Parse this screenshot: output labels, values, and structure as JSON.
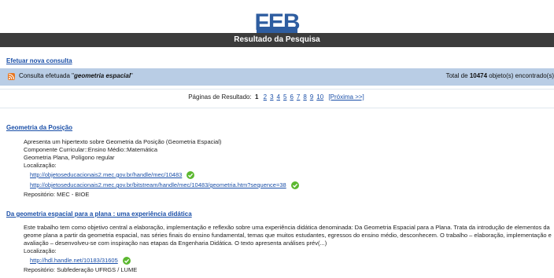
{
  "header": {
    "logo_text": "FEB",
    "title": "Resultado da Pesquisa"
  },
  "new_query_link": "Efetuar nova consulta",
  "query_bar": {
    "prefix": "Consulta efetuada \"",
    "query": "geometria espacial",
    "suffix": "\"",
    "total_prefix": "Total de ",
    "total_count": "10474",
    "total_suffix": " objeto(s) encontrado(s)"
  },
  "pagination": {
    "label": "Páginas de Resultado:",
    "current": "1",
    "pages": [
      "2",
      "3",
      "4",
      "5",
      "6",
      "7",
      "8",
      "9",
      "10"
    ],
    "next": "[Próxima >>]"
  },
  "results": [
    {
      "title": "Geometria da Posição",
      "lines": [
        "Apresenta um hipertexto sobre Geometria da Posição (Geometria Espacial)",
        "Componente Curricular::Ensino Médio::Matemática",
        "Geometria Plana, Polígono regular",
        "Localização:"
      ],
      "links": [
        "http://objetoseducacionais2.mec.gov.br/handle/mec/10483",
        "http://objetoseducacionais2.mec.gov.br/bitstream/handle/mec/10483/geometria.htm?sequence=38"
      ],
      "repository": "Repositório: MEC - BIOE"
    },
    {
      "title": "Da geometria espacial para a plana : uma experiência didática",
      "description": "Este trabalho tem como objetivo central a elaboração, implementação e reflexão sobre uma experiência didática denominada: Da Geometria Espacial para a Plana. Trata da introdução de elementos da geome plana a partir da geometria espacial, nas séries finais do ensino fundamental, temas que muitos estudantes, egressos do ensino médio, desconhecem. O trabalho – elaboração, implementação e avaliação – desenvolveu-se com inspiração nas etapas da Engenharia Didática. O texto apresenta análises prév(...)",
      "location_label": "Localização:",
      "links": [
        "http://hdl.handle.net/10183/31605"
      ],
      "repository": "Repositório: Subfederação UFRGS / LUME"
    }
  ],
  "colors": {
    "title_bar": "#3c3c3c",
    "query_bar": "#b9cde5",
    "link": "#1a4fa8",
    "check": "#5cb830",
    "rss": "#e8761f"
  },
  "icons": {
    "rss": "rss-icon",
    "verified": "check-circle-icon"
  }
}
